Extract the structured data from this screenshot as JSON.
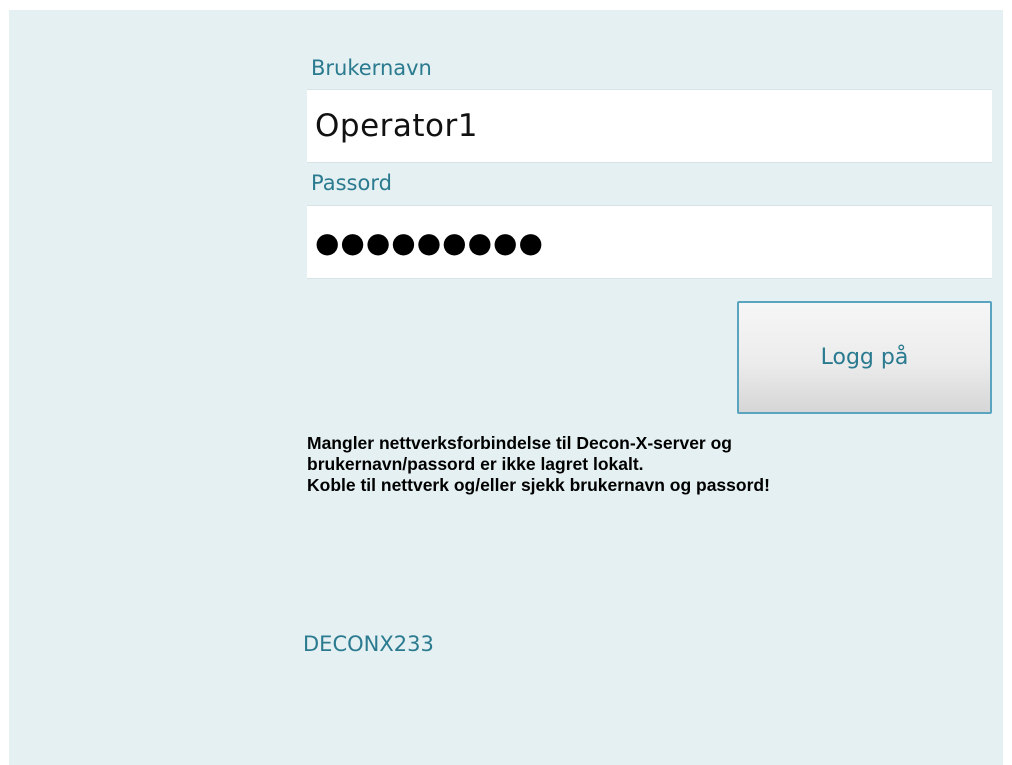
{
  "login": {
    "username_label": "Brukernavn",
    "username_value": "Operator1",
    "password_label": "Passord",
    "password_masked": "●●●●●●●●●",
    "submit_label": "Logg på"
  },
  "message": {
    "lines": [
      "Mangler nettverksforbindelse til Decon-X-server og",
      "brukernavn/passord er ikke lagret lokalt.",
      "Koble til nettverk og/eller sjekk brukernavn og passord!"
    ]
  },
  "footer": {
    "device_id": "DECONX233"
  },
  "colors": {
    "background": "#e4f0f1",
    "accent": "#2a7a90",
    "button_border": "#5aa4c0"
  }
}
